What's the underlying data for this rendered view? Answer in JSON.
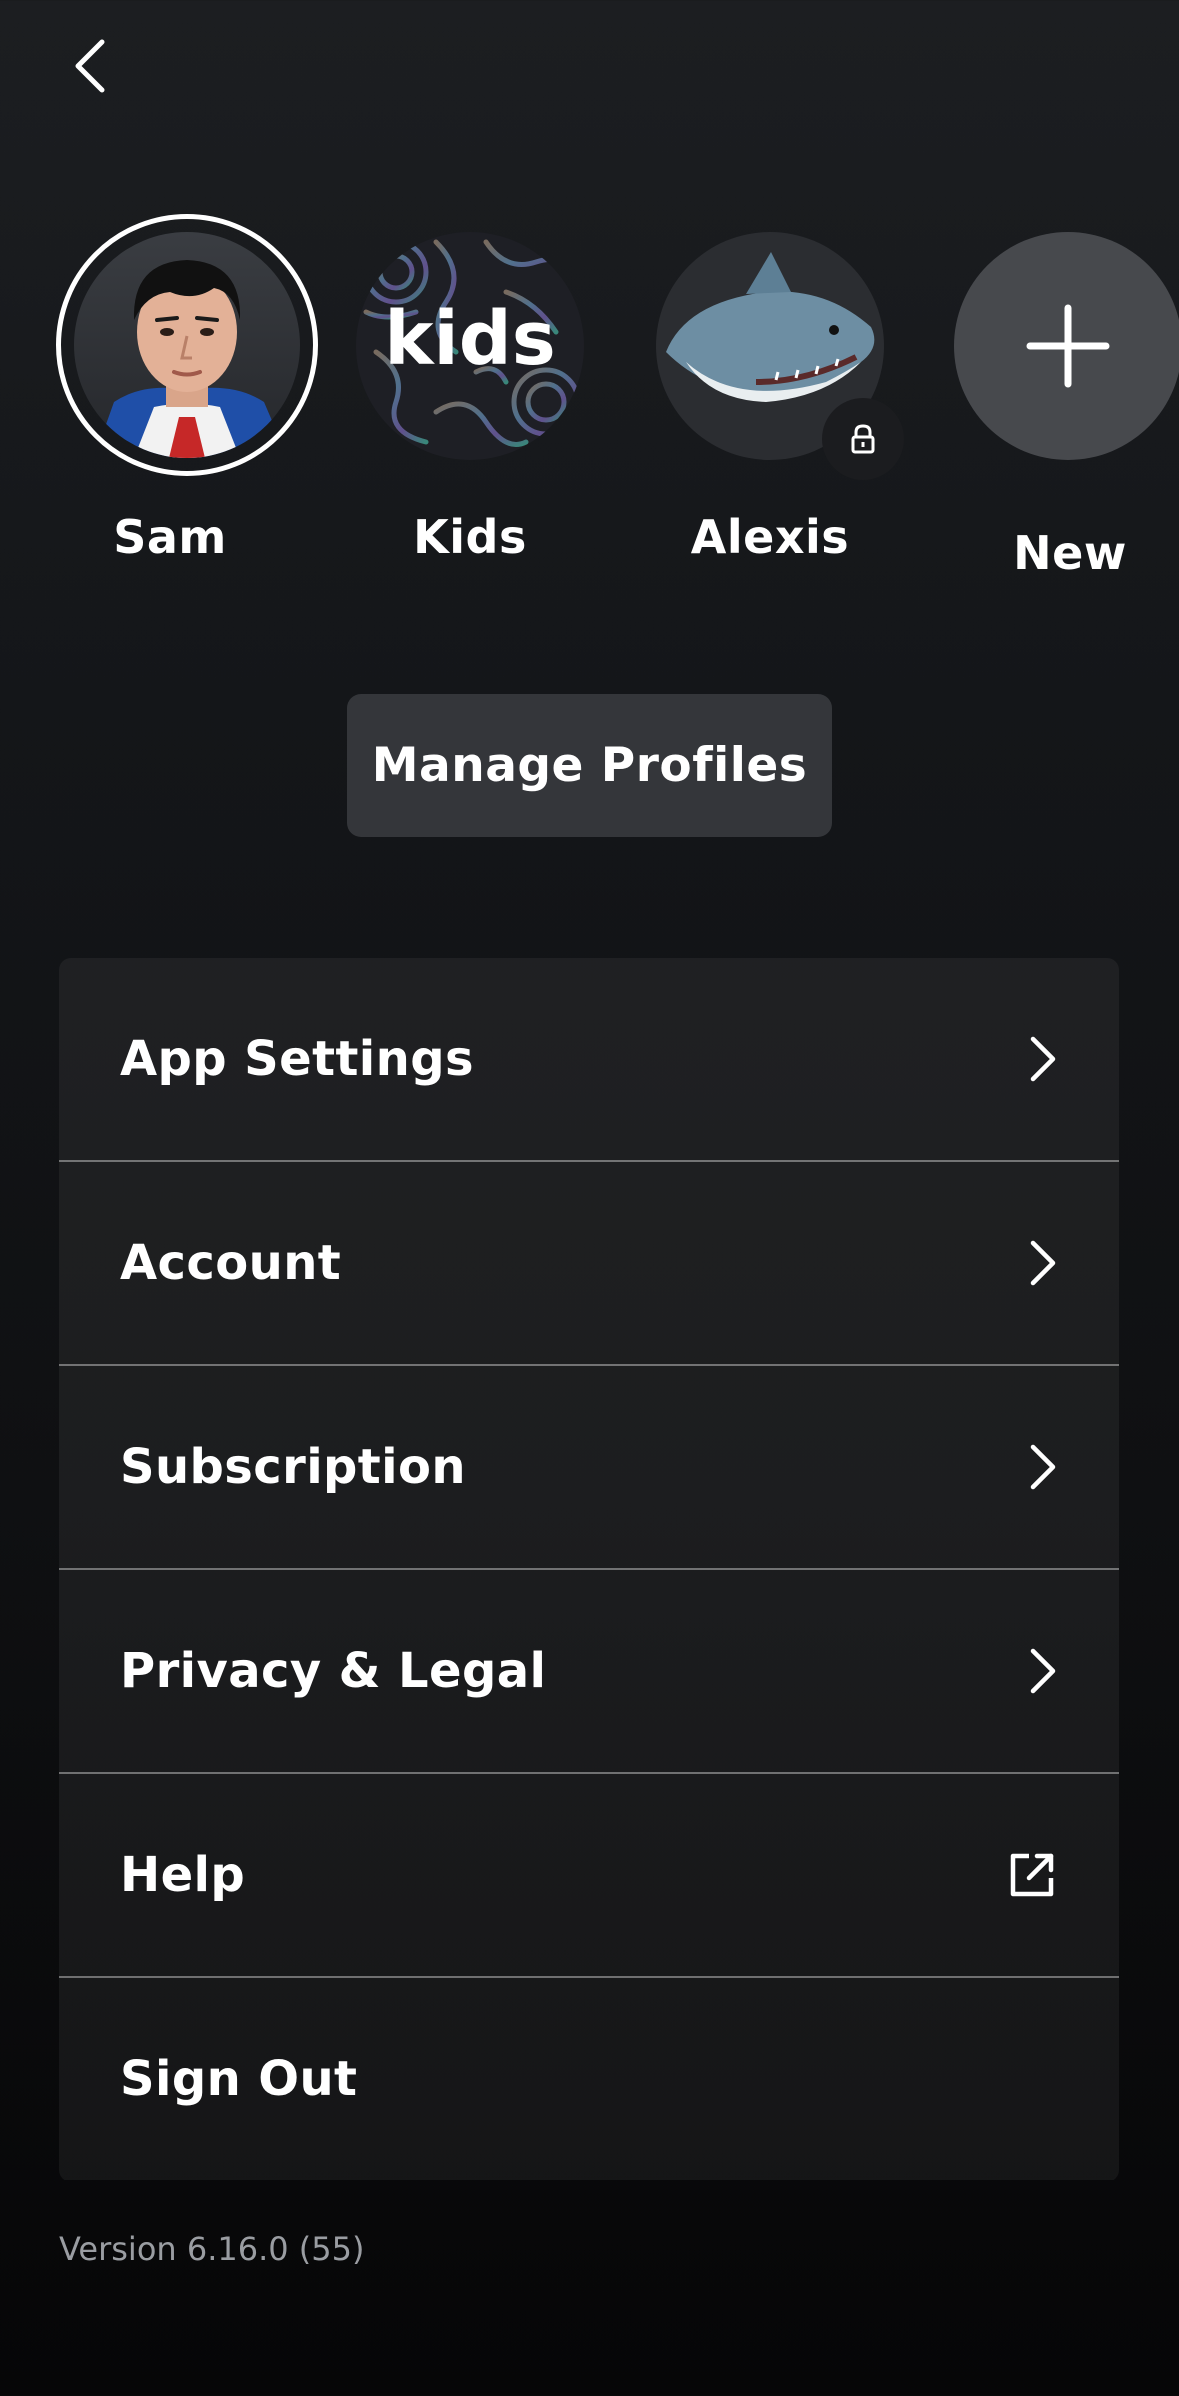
{
  "header": {
    "back_icon": "chevron-left-icon"
  },
  "profiles": [
    {
      "name": "Sam",
      "selected": true,
      "avatar": "portrait-avatar"
    },
    {
      "name": "Kids",
      "selected": false,
      "avatar": "kids-avatar",
      "avatar_text": "kids"
    },
    {
      "name": "Alexis",
      "selected": false,
      "avatar": "shark-avatar",
      "locked": true
    },
    {
      "name": "New",
      "selected": false,
      "avatar": "plus-icon"
    }
  ],
  "manage_profiles": {
    "label": "Manage Profiles"
  },
  "menu": [
    {
      "label": "App Settings",
      "icon": "chevron-right-icon"
    },
    {
      "label": "Account",
      "icon": "chevron-right-icon"
    },
    {
      "label": "Subscription",
      "icon": "chevron-right-icon"
    },
    {
      "label": "Privacy & Legal",
      "icon": "chevron-right-icon"
    },
    {
      "label": "Help",
      "icon": "external-link-icon"
    },
    {
      "label": "Sign Out",
      "icon": ""
    }
  ],
  "footer": {
    "version": "Version 6.16.0 (55)"
  },
  "colors": {
    "background_top": "#1c1e21",
    "background_bottom": "#060607",
    "button_bg": "#34363a",
    "text": "#ffffff",
    "muted_text": "#9a9da2"
  }
}
